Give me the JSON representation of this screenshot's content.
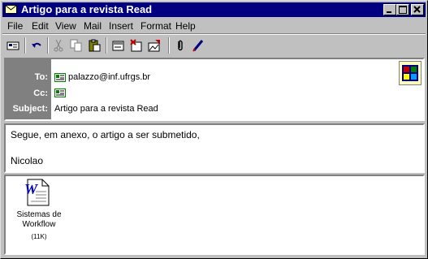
{
  "window": {
    "title": "Artigo para a revista Read"
  },
  "menu": {
    "items": [
      "File",
      "Edit",
      "View",
      "Mail",
      "Insert",
      "Format",
      "Help"
    ]
  },
  "toolbar": {
    "icons": [
      "send-icon",
      "undo-icon",
      "cut-icon",
      "copy-icon",
      "paste-icon",
      "check-names-icon",
      "select-recipients-icon",
      "insert-file-icon",
      "attach-icon",
      "signature-icon"
    ]
  },
  "header": {
    "to_label": "To:",
    "to_value": "palazzo@inf.ufrgs.br",
    "cc_label": "Cc:",
    "cc_value": "",
    "subject_label": "Subject:",
    "subject_value": "Artigo para a revista Read"
  },
  "message": {
    "line1": "Segue, em anexo, o artigo a ser submetido,",
    "line2": "Nicolao"
  },
  "attachment": {
    "name_line1": "Sistemas de",
    "name_line2": "Workflow",
    "size": "(11K)",
    "icon_letter": "W"
  }
}
